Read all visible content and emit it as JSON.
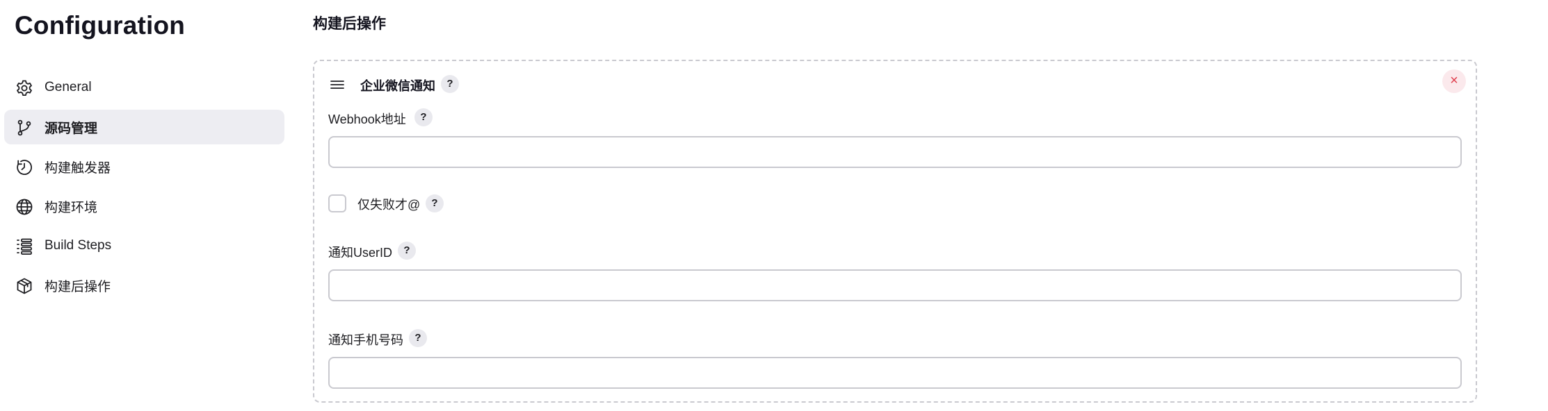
{
  "sidebar": {
    "title": "Configuration",
    "items": [
      {
        "label": "General",
        "icon": "gear-icon",
        "active": false
      },
      {
        "label": "源码管理",
        "icon": "branch-icon",
        "active": true
      },
      {
        "label": "构建触发器",
        "icon": "clock-icon",
        "active": false
      },
      {
        "label": "构建环境",
        "icon": "globe-icon",
        "active": false
      },
      {
        "label": "Build Steps",
        "icon": "list-icon",
        "active": false
      },
      {
        "label": "构建后操作",
        "icon": "package-icon",
        "active": false
      }
    ]
  },
  "main": {
    "section_title": "构建后操作",
    "card": {
      "title": "企业微信通知",
      "help": "?",
      "close": "×",
      "webhook": {
        "label": "Webhook地址",
        "help": "?",
        "value": ""
      },
      "only_failure": {
        "label": "仅失败才@",
        "help": "?",
        "checked": false
      },
      "user_id": {
        "label": "通知UserID",
        "help": "?",
        "value": ""
      },
      "phone": {
        "label": "通知手机号码",
        "help": "?",
        "value": ""
      }
    }
  },
  "colors": {
    "active_bg": "#ededf2",
    "border": "#c9c9cf",
    "close_bg": "#fbe9ec",
    "close_fg": "#e0404f",
    "help_bg": "#e9e9ee"
  }
}
